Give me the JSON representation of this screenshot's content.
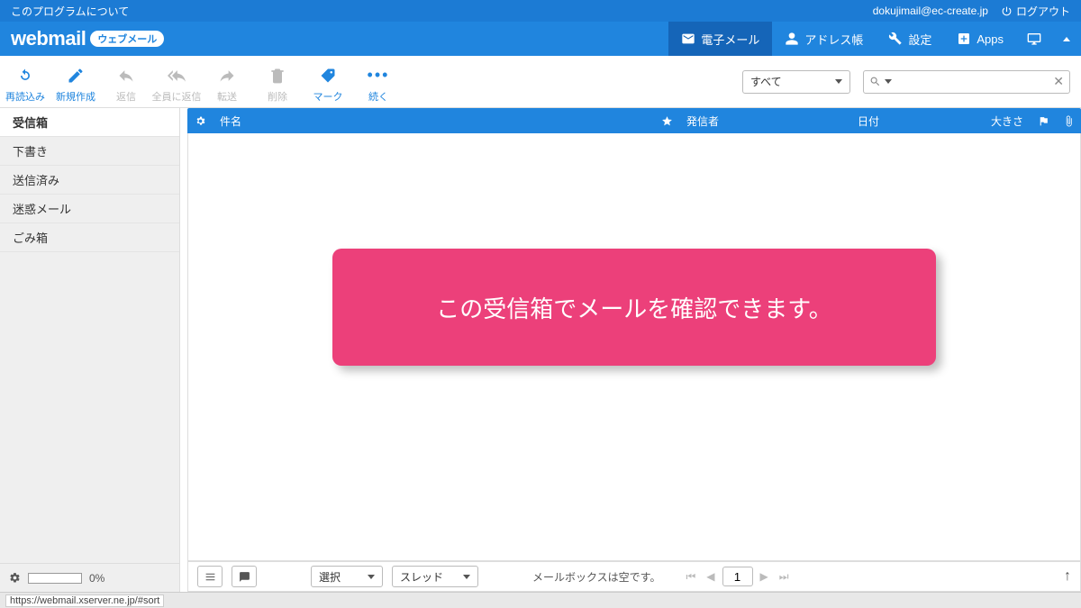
{
  "topbar": {
    "about": "このプログラムについて",
    "user_email": "dokujimail@ec-create.jp",
    "logout": "ログアウト"
  },
  "logo": {
    "text": "webmail",
    "badge": "ウェブメール"
  },
  "nav": {
    "email": "電子メール",
    "addressbook": "アドレス帳",
    "settings": "設定",
    "apps": "Apps"
  },
  "toolbar": {
    "refresh": "再読込み",
    "compose": "新規作成",
    "reply": "返信",
    "replyall": "全員に返信",
    "forward": "転送",
    "delete": "削除",
    "mark": "マーク",
    "more": "続く",
    "filter_selected": "すべて",
    "search_placeholder": ""
  },
  "folders": {
    "inbox": "受信箱",
    "drafts": "下書き",
    "sent": "送信済み",
    "junk": "迷惑メール",
    "trash": "ごみ箱"
  },
  "columns": {
    "subject": "件名",
    "from": "発信者",
    "date": "日付",
    "size": "大きさ"
  },
  "callout": {
    "text": "この受信箱でメールを確認できます。"
  },
  "bottombar": {
    "select_label": "選択",
    "thread_label": "スレッド",
    "empty_msg": "メールボックスは空です。",
    "page": "1"
  },
  "quota": {
    "percent": "0%"
  },
  "statusbar": {
    "url": "https://webmail.xserver.ne.jp/#sort"
  }
}
